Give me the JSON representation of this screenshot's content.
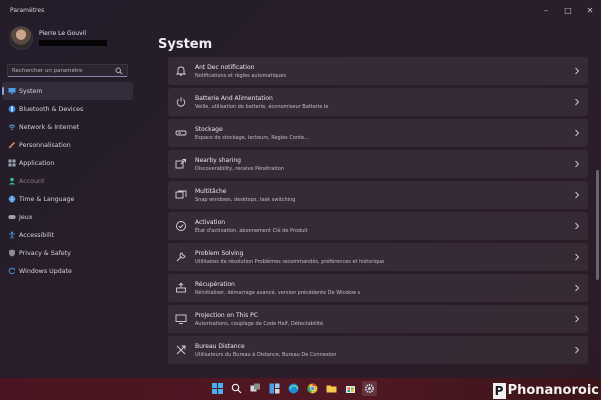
{
  "window": {
    "title": "Paramètres"
  },
  "profile": {
    "name": "Pierre Le Gouvil"
  },
  "search": {
    "placeholder": "Rechercher un paramètre"
  },
  "sidebar": {
    "items": [
      {
        "label": "System",
        "icon": "monitor-icon",
        "active": true
      },
      {
        "label": "Bluetooth & Devices",
        "icon": "bluetooth-icon"
      },
      {
        "label": "Network & Internet",
        "icon": "wifi-icon"
      },
      {
        "label": "Personnalisation",
        "icon": "brush-icon"
      },
      {
        "label": "Application",
        "icon": "apps-icon"
      },
      {
        "label": "Account",
        "icon": "account-icon",
        "dim": true
      },
      {
        "label": "Time & Language",
        "icon": "globe-icon"
      },
      {
        "label": "Jeux",
        "icon": "gamepad-icon"
      },
      {
        "label": "Accessibilit",
        "icon": "accessibility-icon"
      },
      {
        "label": "Privacy & Safety",
        "icon": "shield-icon"
      },
      {
        "label": "Windows Update",
        "icon": "update-icon"
      }
    ]
  },
  "main": {
    "title": "System",
    "cards": [
      {
        "title": "Ant Dec notification",
        "desc": "Notifications et règles automatiques",
        "icon": "notification-icon"
      },
      {
        "title": "Batterie And Alimentation",
        "desc": "Veille, utilisation de batterie, économiseur Batterie le",
        "icon": "power-icon"
      },
      {
        "title": "Stockage",
        "desc": "Espace de stockage, lecteurs, Règles Conte...",
        "icon": "storage-icon"
      },
      {
        "title": "Nearby sharing",
        "desc": "Discoverability, receive Pénétration",
        "icon": "share-icon"
      },
      {
        "title": "Multitâche",
        "desc": "Snap windows, desktops, task switching",
        "icon": "multitask-icon"
      },
      {
        "title": "Activation",
        "desc": "État d'activation, abonnement Clé de Produit",
        "icon": "activation-icon"
      },
      {
        "title": "Problem Solving",
        "desc": "Utilitaires de résolution Problèmes recommandés, préférences et historique",
        "icon": "wrench-icon"
      },
      {
        "title": "Récupération",
        "desc": "Réinitialiser, démarrage avancé, version précédente De Window s",
        "icon": "recovery-icon"
      },
      {
        "title": "Projection on This PC",
        "desc": "Autorisations, couplage de Code Half, Détectabilité",
        "icon": "projection-icon"
      },
      {
        "title": "Bureau Distance",
        "desc": "Utilisateurs du Bureau à Distance, Bureau De Connexion",
        "icon": "remote-desktop-icon"
      }
    ]
  },
  "taskbar": {
    "icons": [
      "windows-start-icon",
      "search-icon",
      "task-view-icon",
      "widgets-icon",
      "edge-icon",
      "chrome-icon",
      "file-explorer-icon",
      "store-icon",
      "settings-icon"
    ]
  },
  "watermark": {
    "letter": "P",
    "text": "Phonanoroic"
  },
  "colors": {
    "accent": "#7ba7e8",
    "taskbar": "#4a1520"
  }
}
